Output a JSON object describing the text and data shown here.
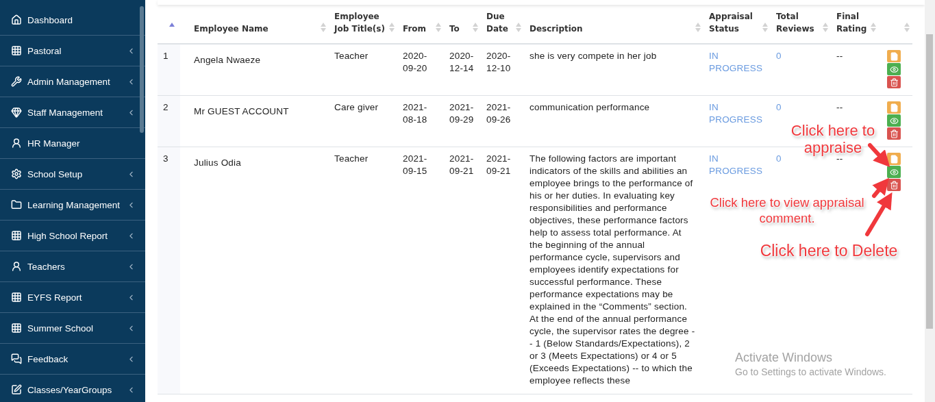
{
  "sidebar": {
    "items": [
      {
        "label": "Dashboard",
        "has_submenu": false
      },
      {
        "label": "Pastoral",
        "has_submenu": true
      },
      {
        "label": "Admin Management",
        "has_submenu": true
      },
      {
        "label": "Staff Management",
        "has_submenu": true
      },
      {
        "label": "HR Manager",
        "has_submenu": false
      },
      {
        "label": "School Setup",
        "has_submenu": true
      },
      {
        "label": "Learning Management",
        "has_submenu": true
      },
      {
        "label": "High School Report",
        "has_submenu": true
      },
      {
        "label": "Teachers",
        "has_submenu": true
      },
      {
        "label": "EYFS Report",
        "has_submenu": true
      },
      {
        "label": "Summer School",
        "has_submenu": true
      },
      {
        "label": "Feedback",
        "has_submenu": true
      },
      {
        "label": "Classes/YearGroups",
        "has_submenu": true
      }
    ]
  },
  "table": {
    "columns": [
      {
        "sorted": true
      },
      {
        "label": "Employee Name",
        "sorted": false
      },
      {
        "label": "Employee Job Title(s)",
        "sorted": false
      },
      {
        "label": "From",
        "sorted": false
      },
      {
        "label": "To",
        "sorted": false
      },
      {
        "label": "Due Date",
        "sorted": false
      },
      {
        "label": "Description",
        "sorted": false
      },
      {
        "label": "Appraisal Status",
        "sorted": false
      },
      {
        "label": "Total Reviews",
        "sorted": false
      },
      {
        "label": "Final Rating",
        "sorted": false
      },
      {
        "sorted": false
      }
    ],
    "rows": [
      {
        "index": "1",
        "name": "Angela Nwaeze",
        "job": "Teacher",
        "from": "2020-09-20",
        "to": "2020-12-14",
        "due": "2020-12-10",
        "description": "she is very compete in her job",
        "status": "IN PROGRESS",
        "reviews": "0",
        "rating": "--",
        "actions": [
          {
            "kind": "appraise"
          },
          {
            "kind": "view"
          },
          {
            "kind": "delete"
          }
        ]
      },
      {
        "index": "2",
        "name": "Mr GUEST ACCOUNT",
        "job": "Care giver",
        "from": "2021-08-18",
        "to": "2021-09-29",
        "due": "2021-09-26",
        "description": "communication performance",
        "status": "IN PROGRESS",
        "reviews": "0",
        "rating": "--",
        "actions": [
          {
            "kind": "appraise"
          },
          {
            "kind": "view"
          },
          {
            "kind": "delete"
          }
        ]
      },
      {
        "index": "3",
        "name": "Julius Odia",
        "job": "Teacher",
        "from": "2021-09-15",
        "to": "2021-09-21",
        "due": "2021-09-21",
        "description": "The following factors are important indicators of the skills and abilities an employee brings to the performance of his or her duties. In evaluating key responsibilities and performance objectives, these performance factors help to assess total performance. At the beginning of the annual performance cycle, supervisors and employees identify expectations for successful performance. These performance expectations may be explained in the “Comments” section. At the end of the annual performance cycle, the supervisor rates the degree -- 1 (Below Standards/Expectations), 2 or 3 (Meets Expectations) or 4 or 5 (Exceeds Expectations) -- to which the employee reflects these",
        "status": "IN PROGRESS",
        "reviews": "0",
        "rating": "--",
        "actions": [
          {
            "kind": "appraise"
          },
          {
            "kind": "view"
          },
          {
            "kind": "delete"
          }
        ]
      }
    ]
  },
  "annotations": [
    {
      "text": "Click here to appraise"
    },
    {
      "text": "Click here to view appraisal comment."
    },
    {
      "text": "Click here to Delete"
    }
  ],
  "os_notice": {
    "title": "Activate Windows",
    "subtitle": "Go to Settings to activate Windows."
  }
}
